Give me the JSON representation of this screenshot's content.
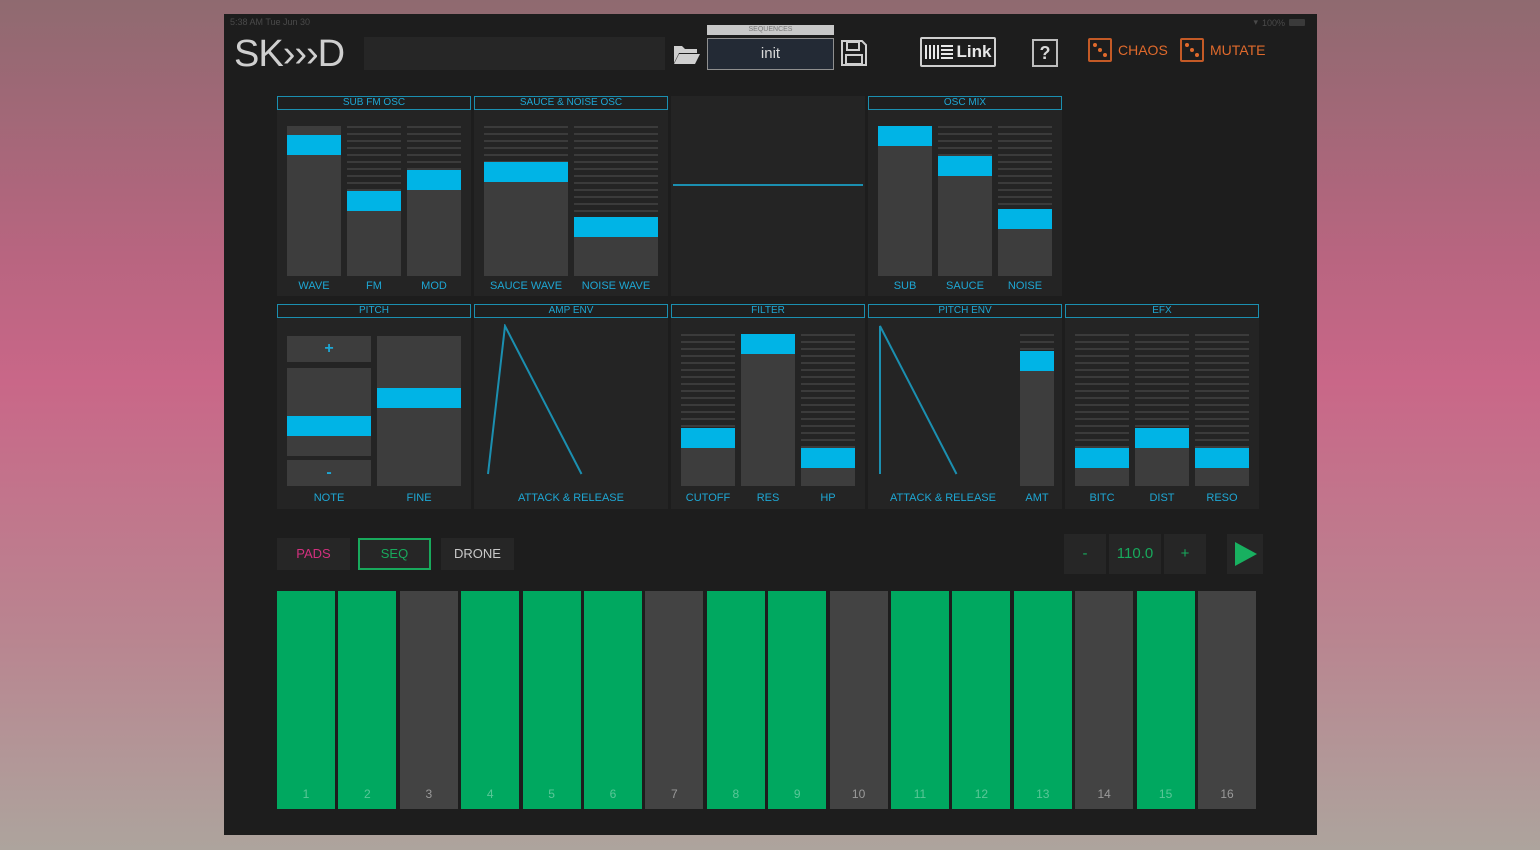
{
  "status_bar": {
    "time": "5:38 AM  Tue Jun 30",
    "battery": "100%"
  },
  "header": {
    "logo": "SK›››D",
    "preset_name": "",
    "sequences_label": "SEQUENCES",
    "sequence_name": "init",
    "link_label": "Link",
    "help_label": "?",
    "chaos_label": "CHAOS",
    "mutate_label": "MUTATE"
  },
  "panels": {
    "sub_fm_osc": {
      "title": "SUB FM OSC",
      "sliders": [
        {
          "label": "WAVE",
          "value": 0.93,
          "ticks": false
        },
        {
          "label": "FM",
          "value": 0.5,
          "ticks": true
        },
        {
          "label": "MOD",
          "value": 0.66,
          "ticks": true
        }
      ]
    },
    "sauce_noise_osc": {
      "title": "SAUCE & NOISE OSC",
      "sliders": [
        {
          "label": "SAUCE WAVE",
          "value": 0.72,
          "ticks": true
        },
        {
          "label": "NOISE WAVE",
          "value": 0.3,
          "ticks": true
        }
      ]
    },
    "osc_mix": {
      "title": "OSC MIX",
      "sliders": [
        {
          "label": "SUB",
          "value": 1.0,
          "ticks": false
        },
        {
          "label": "SAUCE",
          "value": 0.77,
          "ticks": true
        },
        {
          "label": "NOISE",
          "value": 0.36,
          "ticks": true
        }
      ]
    },
    "pitch": {
      "title": "PITCH",
      "note_plus": "+",
      "note_minus": "-",
      "note_label": "NOTE",
      "note_value": 0.3,
      "fine_label": "FINE",
      "fine_value": 0.6
    },
    "amp_env": {
      "title": "AMP ENV",
      "label": "ATTACK & RELEASE",
      "attack": 0.1,
      "release": 0.45
    },
    "filter": {
      "title": "FILTER",
      "sliders": [
        {
          "label": "CUTOFF",
          "value": 0.29,
          "ticks": true
        },
        {
          "label": "RES",
          "value": 1.0,
          "ticks": false
        },
        {
          "label": "HP",
          "value": 0.14,
          "ticks": true
        }
      ]
    },
    "pitch_env": {
      "title": "PITCH ENV",
      "label": "ATTACK & RELEASE",
      "attack": 0.0,
      "release": 0.45,
      "amt_label": "AMT",
      "amt_value": 0.87
    },
    "efx": {
      "title": "EFX",
      "sliders": [
        {
          "label": "BITC",
          "value": 0.14,
          "ticks": true
        },
        {
          "label": "DIST",
          "value": 0.29,
          "ticks": true
        },
        {
          "label": "RESO",
          "value": 0.14,
          "ticks": true
        }
      ]
    }
  },
  "modes": [
    {
      "label": "PADS",
      "color": "#d2307e",
      "selected": false
    },
    {
      "label": "SEQ",
      "color": "#18a95c",
      "selected": true
    },
    {
      "label": "DRONE",
      "color": "#c8c8c8",
      "selected": false
    }
  ],
  "tempo": {
    "minus": "-",
    "value": "110.0",
    "plus": "+"
  },
  "colors": {
    "accent": "#00b4e6",
    "step_on": "#00a860",
    "chaos": "#e06a2c"
  },
  "steps": [
    {
      "n": "1",
      "on": true
    },
    {
      "n": "2",
      "on": true
    },
    {
      "n": "3",
      "on": false
    },
    {
      "n": "4",
      "on": true
    },
    {
      "n": "5",
      "on": true
    },
    {
      "n": "6",
      "on": true
    },
    {
      "n": "7",
      "on": false
    },
    {
      "n": "8",
      "on": true
    },
    {
      "n": "9",
      "on": true
    },
    {
      "n": "10",
      "on": false
    },
    {
      "n": "11",
      "on": true
    },
    {
      "n": "12",
      "on": true
    },
    {
      "n": "13",
      "on": true
    },
    {
      "n": "14",
      "on": false
    },
    {
      "n": "15",
      "on": true
    },
    {
      "n": "16",
      "on": false
    }
  ]
}
